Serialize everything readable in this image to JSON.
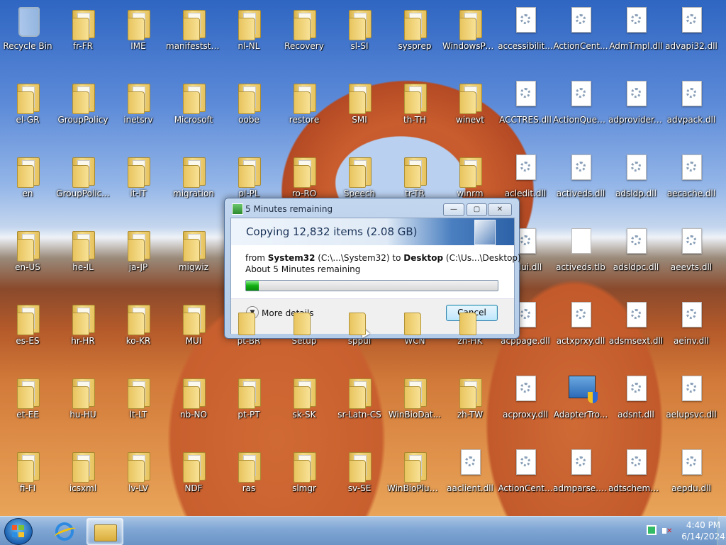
{
  "desktop": {
    "icons": [
      {
        "label": "Recycle Bin",
        "kind": "bin"
      },
      {
        "label": "fr-FR",
        "kind": "folder"
      },
      {
        "label": "IME",
        "kind": "folder"
      },
      {
        "label": "manifeststore",
        "kind": "folder"
      },
      {
        "label": "nl-NL",
        "kind": "folder"
      },
      {
        "label": "Recovery",
        "kind": "folder"
      },
      {
        "label": "sl-SI",
        "kind": "folder"
      },
      {
        "label": "sysprep",
        "kind": "folder"
      },
      {
        "label": "WindowsPo...",
        "kind": "folder"
      },
      {
        "label": "accessibilit...",
        "kind": "dll"
      },
      {
        "label": "ActionCent...",
        "kind": "dll"
      },
      {
        "label": "AdmTmpl.dll",
        "kind": "dll"
      },
      {
        "label": "advapi32.dll",
        "kind": "dll"
      },
      {
        "label": "el-GR",
        "kind": "folder"
      },
      {
        "label": "GroupPolicy",
        "kind": "folder"
      },
      {
        "label": "inetsrv",
        "kind": "folder"
      },
      {
        "label": "Microsoft",
        "kind": "folder"
      },
      {
        "label": "oobe",
        "kind": "folder"
      },
      {
        "label": "restore",
        "kind": "folder"
      },
      {
        "label": "SMI",
        "kind": "folder"
      },
      {
        "label": "th-TH",
        "kind": "folder"
      },
      {
        "label": "winevt",
        "kind": "folder"
      },
      {
        "label": "ACCTRES.dll",
        "kind": "dll"
      },
      {
        "label": "ActionQueu...",
        "kind": "dll"
      },
      {
        "label": "adprovider.dll",
        "kind": "dll"
      },
      {
        "label": "advpack.dll",
        "kind": "dll"
      },
      {
        "label": "en",
        "kind": "folder"
      },
      {
        "label": "GroupPolic...",
        "kind": "folder"
      },
      {
        "label": "it-IT",
        "kind": "folder"
      },
      {
        "label": "migration",
        "kind": "folder"
      },
      {
        "label": "pl-PL",
        "kind": "folder"
      },
      {
        "label": "ro-RO",
        "kind": "folder"
      },
      {
        "label": "Speech",
        "kind": "folder"
      },
      {
        "label": "tr-TR",
        "kind": "folder"
      },
      {
        "label": "winrm",
        "kind": "folder"
      },
      {
        "label": "acledit.dll",
        "kind": "dll"
      },
      {
        "label": "activeds.dll",
        "kind": "dll"
      },
      {
        "label": "adsldp.dll",
        "kind": "dll"
      },
      {
        "label": "aecache.dll",
        "kind": "dll"
      },
      {
        "label": "en-US",
        "kind": "folder"
      },
      {
        "label": "he-IL",
        "kind": "folder"
      },
      {
        "label": "ja-JP",
        "kind": "folder"
      },
      {
        "label": "migwiz",
        "kind": "folder"
      },
      {
        "label": "aclui.dll",
        "kind": "dll"
      },
      {
        "label": "activeds.tlb",
        "kind": "file"
      },
      {
        "label": "adsldpc.dll",
        "kind": "dll"
      },
      {
        "label": "aeevts.dll",
        "kind": "dll"
      },
      {
        "label": "es-ES",
        "kind": "folder"
      },
      {
        "label": "hr-HR",
        "kind": "folder"
      },
      {
        "label": "ko-KR",
        "kind": "folder"
      },
      {
        "label": "MUI",
        "kind": "folder"
      },
      {
        "label": "pt-BR",
        "kind": "folder"
      },
      {
        "label": "Setup",
        "kind": "folder"
      },
      {
        "label": "sppui",
        "kind": "folder"
      },
      {
        "label": "WCN",
        "kind": "folder"
      },
      {
        "label": "zh-HK",
        "kind": "folder"
      },
      {
        "label": "acppage.dll",
        "kind": "dll"
      },
      {
        "label": "actxprxy.dll",
        "kind": "dll"
      },
      {
        "label": "adsmsext.dll",
        "kind": "dll"
      },
      {
        "label": "aeinv.dll",
        "kind": "dll"
      },
      {
        "label": "et-EE",
        "kind": "folder"
      },
      {
        "label": "hu-HU",
        "kind": "folder"
      },
      {
        "label": "lt-LT",
        "kind": "folder"
      },
      {
        "label": "nb-NO",
        "kind": "folder"
      },
      {
        "label": "pt-PT",
        "kind": "folder"
      },
      {
        "label": "sk-SK",
        "kind": "folder"
      },
      {
        "label": "sr-Latn-CS",
        "kind": "folder"
      },
      {
        "label": "WinBioDat...",
        "kind": "folder"
      },
      {
        "label": "zh-TW",
        "kind": "folder"
      },
      {
        "label": "acproxy.dll",
        "kind": "dll"
      },
      {
        "label": "AdapterTro...",
        "kind": "shield"
      },
      {
        "label": "adsnt.dll",
        "kind": "dll"
      },
      {
        "label": "aelupsvc.dll",
        "kind": "dll"
      },
      {
        "label": "fi-FI",
        "kind": "folder"
      },
      {
        "label": "icsxml",
        "kind": "folder"
      },
      {
        "label": "lv-LV",
        "kind": "folder"
      },
      {
        "label": "NDF",
        "kind": "folder"
      },
      {
        "label": "ras",
        "kind": "folder"
      },
      {
        "label": "slmgr",
        "kind": "folder"
      },
      {
        "label": "sv-SE",
        "kind": "folder"
      },
      {
        "label": "WinBioPlug...",
        "kind": "folder"
      },
      {
        "label": "aaclient.dll",
        "kind": "dll"
      },
      {
        "label": "ActionCent...",
        "kind": "dll"
      },
      {
        "label": "admparse.dll",
        "kind": "dll"
      },
      {
        "label": "adtschema.dll",
        "kind": "dll"
      },
      {
        "label": "aepdu.dll",
        "kind": "dll"
      }
    ]
  },
  "dialog": {
    "title": "5 Minutes remaining",
    "heading": "Copying 12,832 items (2.08 GB)",
    "from_prefix": "from ",
    "from_name": "System32",
    "from_path": " (C:\\...\\System32)",
    "to_prefix": "   to ",
    "to_name": "Desktop",
    "to_path": " (C:\\Us...\\Desktop)",
    "remaining": "About 5 Minutes remaining",
    "progress_percent": 5,
    "more_details": "More details",
    "cancel": "Cancel",
    "min_glyph": "—",
    "max_glyph": "▢",
    "close_glyph": "✕"
  },
  "taskbar": {
    "pinned": [
      {
        "name": "internet-explorer-icon"
      },
      {
        "name": "windows-explorer-icon"
      }
    ],
    "clock_time": "4:40 PM",
    "clock_date": "6/14/2024"
  }
}
